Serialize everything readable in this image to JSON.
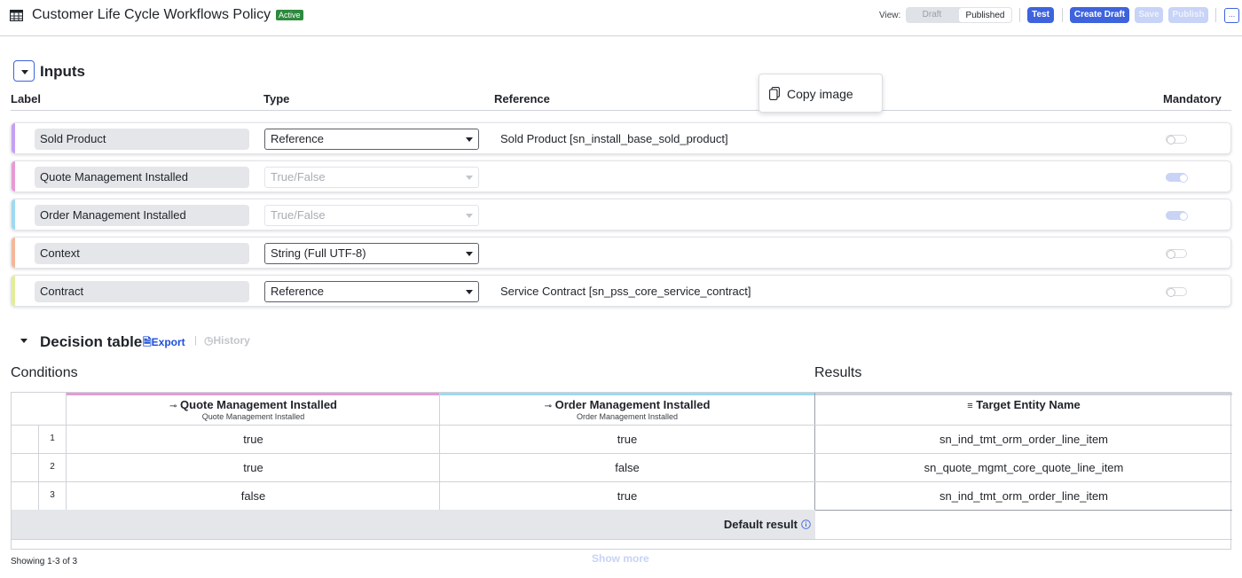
{
  "header": {
    "title": "Customer Life Cycle Workflows Policy",
    "status": "Active",
    "view_label": "View:",
    "view_options": [
      "Draft",
      "Published"
    ],
    "buttons": {
      "test": "Test",
      "create_draft": "Create Draft",
      "save": "Save",
      "publish": "Publish",
      "more": "..."
    }
  },
  "popup": {
    "label": "Copy image"
  },
  "inputs": {
    "title": "Inputs",
    "columns": {
      "label": "Label",
      "type": "Type",
      "reference": "Reference",
      "mandatory": "Mandatory"
    },
    "rows": [
      {
        "label": "Sold Product",
        "type": "Reference",
        "reference": "Sold Product [sn_install_base_sold_product]",
        "mandatory": false,
        "type_disabled": false,
        "accent": "#c6a0f2"
      },
      {
        "label": "Quote Management Installed",
        "type": "True/False",
        "reference": "",
        "mandatory": true,
        "type_disabled": true,
        "accent": "#e69ad6"
      },
      {
        "label": "Order Management Installed",
        "type": "True/False",
        "reference": "",
        "mandatory": true,
        "type_disabled": true,
        "accent": "#9edaf0"
      },
      {
        "label": "Context",
        "type": "String (Full UTF-8)",
        "reference": "",
        "mandatory": false,
        "type_disabled": false,
        "accent": "#f3b79b"
      },
      {
        "label": "Contract",
        "type": "Reference",
        "reference": "Service Contract [sn_pss_core_service_contract]",
        "mandatory": false,
        "type_disabled": false,
        "accent": "#e3ec9c"
      }
    ]
  },
  "decision_table": {
    "title": "Decision table",
    "export": "Export",
    "history": "History",
    "conditions_label": "Conditions",
    "results_label": "Results",
    "columns": [
      {
        "title": "Quote Management Installed",
        "subtitle": "Quote Management Installed",
        "accent": "#e69ad6"
      },
      {
        "title": "Order Management Installed",
        "subtitle": "Order Management Installed",
        "accent": "#9edaf0"
      },
      {
        "title": "Target Entity Name",
        "subtitle": ""
      }
    ],
    "rows": [
      {
        "num": "1",
        "c1": "true",
        "c2": "true",
        "result": "sn_ind_tmt_orm_order_line_item"
      },
      {
        "num": "2",
        "c1": "true",
        "c2": "false",
        "result": "sn_quote_mgmt_core_quote_line_item"
      },
      {
        "num": "3",
        "c1": "false",
        "c2": "true",
        "result": "sn_ind_tmt_orm_order_line_item"
      }
    ],
    "default_result_label": "Default result",
    "showing": "Showing 1-3 of 3",
    "show_more": "Show more"
  }
}
